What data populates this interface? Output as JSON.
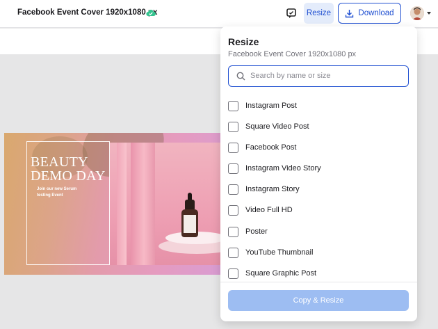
{
  "topbar": {
    "doc_title": "Facebook Event Cover 1920x1080 px",
    "resize_label": "Resize",
    "download_label": "Download",
    "accent_color": "#1f4fd1"
  },
  "design": {
    "title": "BEAUTY DEMO DAY",
    "subtitle": "Join our new Serum testing Event"
  },
  "resize_panel": {
    "title": "Resize",
    "subtitle": "Facebook Event Cover 1920x1080 px",
    "search_placeholder": "Search by name or size",
    "search_value": "",
    "options": [
      {
        "label": "Instagram Post",
        "checked": false
      },
      {
        "label": "Square Video Post",
        "checked": false
      },
      {
        "label": "Facebook Post",
        "checked": false
      },
      {
        "label": "Instagram Video Story",
        "checked": false
      },
      {
        "label": "Instagram Story",
        "checked": false
      },
      {
        "label": "Video Full HD",
        "checked": false
      },
      {
        "label": "Poster",
        "checked": false
      },
      {
        "label": "YouTube Thumbnail",
        "checked": false
      },
      {
        "label": "Square Graphic Post",
        "checked": false
      }
    ],
    "action_label": "Copy & Resize",
    "action_color": "#9dbdf2"
  }
}
